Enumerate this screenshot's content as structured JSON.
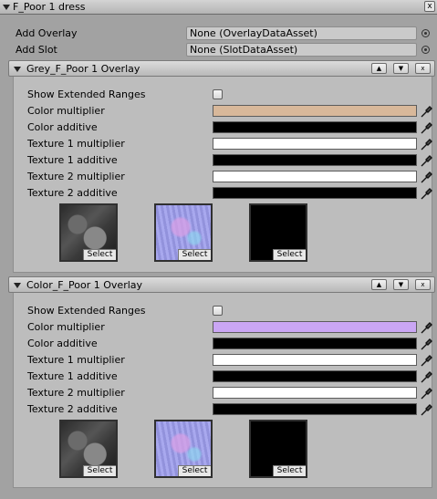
{
  "header": {
    "title": "F_Poor 1 dress",
    "close_label": "x"
  },
  "add_overlay": {
    "label": "Add Overlay",
    "value": "None (OverlayDataAsset)"
  },
  "add_slot": {
    "label": "Add Slot",
    "value": "None (SlotDataAsset)"
  },
  "overlays": [
    {
      "title": "Grey_F_Poor 1 Overlay",
      "buttons": {
        "up": "▲",
        "down": "▼",
        "remove": "x"
      },
      "show_extended_ranges": {
        "label": "Show Extended Ranges",
        "checked": false
      },
      "rows": [
        {
          "label": "Color multiplier",
          "color": "#d8b89a"
        },
        {
          "label": "Color additive",
          "color": "#000000"
        },
        {
          "label": "Texture 1 multiplier",
          "color": "#ffffff"
        },
        {
          "label": "Texture 1 additive",
          "color": "#000000"
        },
        {
          "label": "Texture 2 multiplier",
          "color": "#ffffff"
        },
        {
          "label": "Texture 2 additive",
          "color": "#000000"
        }
      ],
      "textures": [
        {
          "kind": "diffuse-dark",
          "select_label": "Select"
        },
        {
          "kind": "normal-map",
          "select_label": "Select"
        },
        {
          "kind": "black",
          "select_label": "Select"
        }
      ]
    },
    {
      "title": "Color_F_Poor 1 Overlay",
      "buttons": {
        "up": "▲",
        "down": "▼",
        "remove": "x"
      },
      "show_extended_ranges": {
        "label": "Show Extended Ranges",
        "checked": false
      },
      "rows": [
        {
          "label": "Color multiplier",
          "color": "#caa6f4"
        },
        {
          "label": "Color additive",
          "color": "#000000"
        },
        {
          "label": "Texture 1 multiplier",
          "color": "#ffffff"
        },
        {
          "label": "Texture 1 additive",
          "color": "#000000"
        },
        {
          "label": "Texture 2 multiplier",
          "color": "#ffffff"
        },
        {
          "label": "Texture 2 additive",
          "color": "#000000"
        }
      ],
      "textures": [
        {
          "kind": "diffuse-dark",
          "select_label": "Select"
        },
        {
          "kind": "normal-map",
          "select_label": "Select"
        },
        {
          "kind": "black",
          "select_label": "Select"
        }
      ]
    }
  ]
}
